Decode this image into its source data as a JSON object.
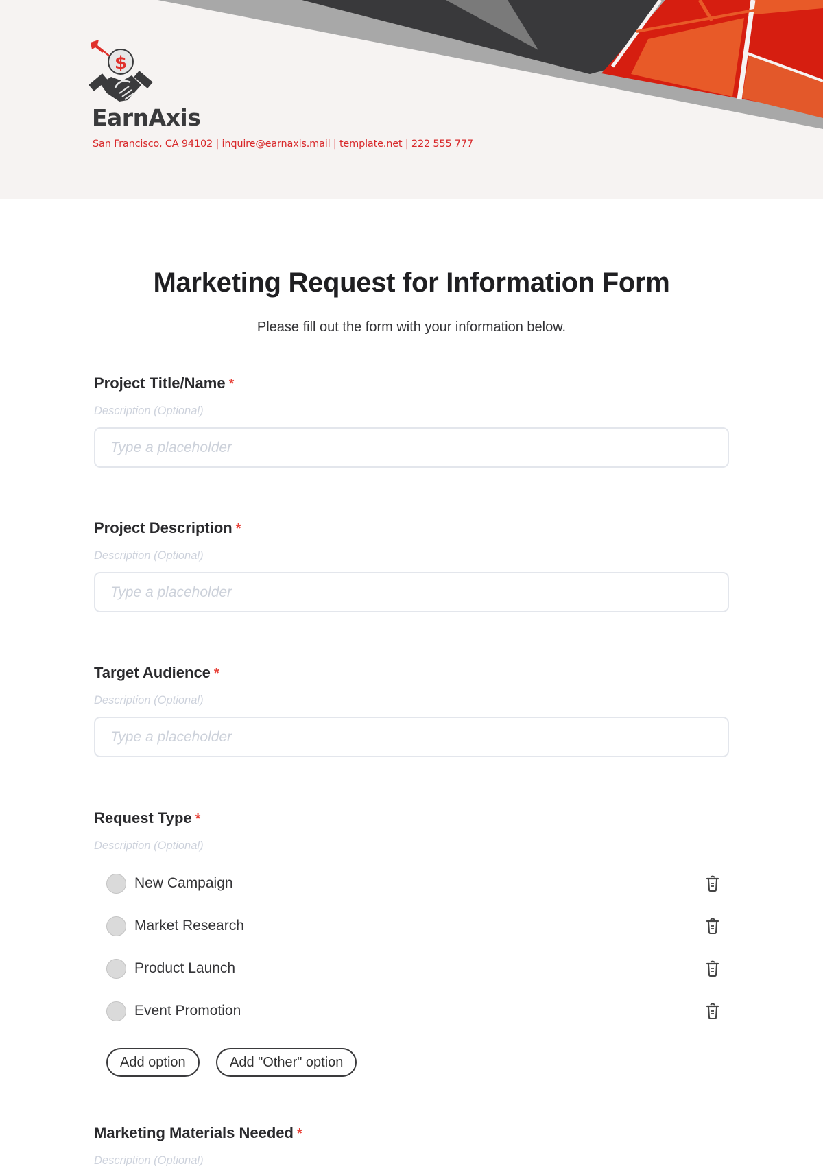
{
  "brand": {
    "name": "EarnAxis",
    "contact_line": "San Francisco, CA 94102 | inquire@earnaxis.mail | template.net | 222 555 777",
    "logo_icon": "handshake-dollar-target-icon",
    "colors": {
      "accent": "#d8282a",
      "dark": "#39393b",
      "gray": "#a8a8a8",
      "orange": "#e85a28",
      "header_bg": "#f6f3f2"
    }
  },
  "form": {
    "title": "Marketing Request for Information Form",
    "subtitle": "Please fill out the form with your information below.",
    "required_marker": "*",
    "fields": [
      {
        "label": "Project Title/Name",
        "description": "Description (Optional)",
        "placeholder": "Type a placeholder",
        "value": ""
      },
      {
        "label": "Project Description",
        "description": "Description (Optional)",
        "placeholder": "Type a placeholder",
        "value": ""
      },
      {
        "label": "Target Audience",
        "description": "Description (Optional)",
        "placeholder": "Type a placeholder",
        "value": ""
      }
    ],
    "request_type": {
      "label": "Request Type",
      "description": "Description (Optional)",
      "options": [
        {
          "label": "New Campaign",
          "selected": false,
          "delete_icon": "trash-icon"
        },
        {
          "label": "Market Research",
          "selected": false,
          "delete_icon": "trash-icon"
        },
        {
          "label": "Product Launch",
          "selected": false,
          "delete_icon": "trash-icon"
        },
        {
          "label": "Event Promotion",
          "selected": false,
          "delete_icon": "trash-icon"
        }
      ],
      "add_option_label": "Add option",
      "add_other_label": "Add \"Other\" option"
    },
    "materials": {
      "label": "Marketing Materials Needed",
      "description": "Description (Optional)"
    }
  }
}
